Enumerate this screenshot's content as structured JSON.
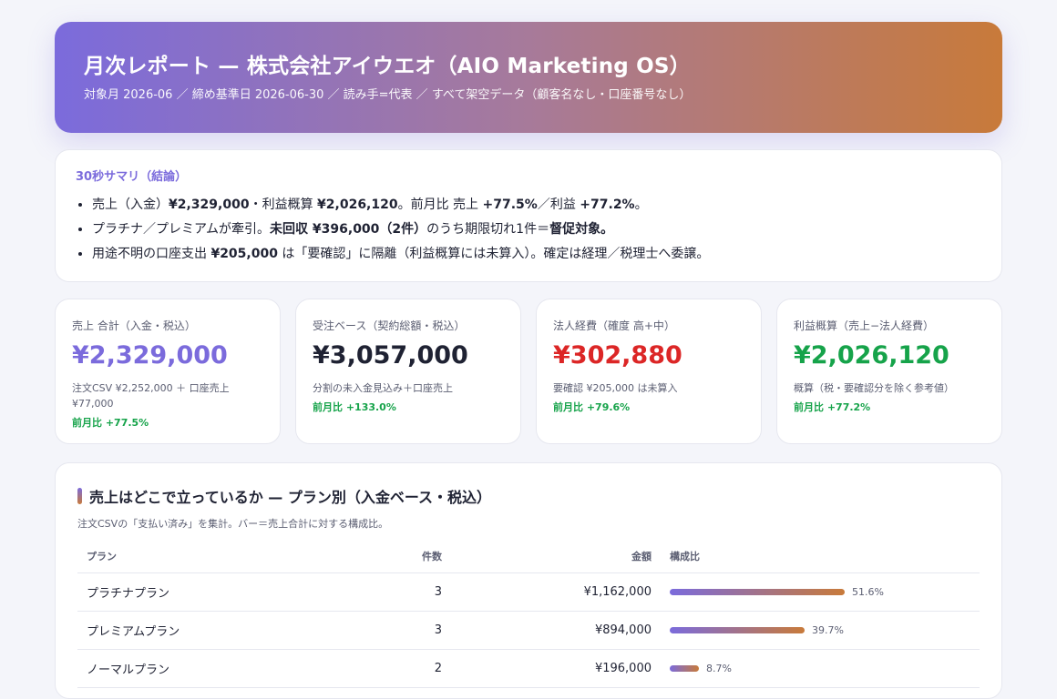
{
  "header": {
    "title": "月次レポート — 株式会社アイウエオ（AIO Marketing OS）",
    "subtitle": "対象月 2026-06 ／ 締め基準日 2026-06-30 ／ 読み手=代表 ／ すべて架空データ（顧客名なし・口座番号なし）"
  },
  "summary": {
    "label": "30秒サマリ（結論）",
    "bullet1": {
      "a": "売上（入金）",
      "b": "¥2,329,000",
      "c": "・利益概算 ",
      "d": "¥2,026,120",
      "e": "。前月比 売上 ",
      "f": "+77.5%",
      "g": "／利益 ",
      "h": "+77.2%",
      "i": "。"
    },
    "bullet2": {
      "a": "プラチナ／プレミアムが牽引。",
      "b": "未回収 ¥396,000（2件）",
      "c": "のうち期限切れ1件＝",
      "d": "督促対象。"
    },
    "bullet3": {
      "a": "用途不明の口座支出 ",
      "b": "¥205,000",
      "c": " は「要確認」に隔離（利益概算には未算入）。確定は経理／税理士へ委譲。"
    }
  },
  "kpis": [
    {
      "title": "売上 合計（入金・税込）",
      "value": "¥2,329,000",
      "note": "注文CSV ¥2,252,000 ＋ 口座売上 ¥77,000",
      "delta": "前月比 +77.5%",
      "color": "#7b6bdc"
    },
    {
      "title": "受注ベース（契約総額・税込）",
      "value": "¥3,057,000",
      "note": "分割の未入金見込み＋口座売上",
      "delta": "前月比 +133.0%",
      "color": "#1f2233"
    },
    {
      "title": "法人経費（確度 高+中）",
      "value": "¥302,880",
      "note": "要確認 ¥205,000 は未算入",
      "delta": "前月比 +79.6%",
      "color": "#dc2626"
    },
    {
      "title": "利益概算（売上−法人経費）",
      "value": "¥2,026,120",
      "note": "概算（税・要確認分を除く参考値）",
      "delta": "前月比 +77.2%",
      "color": "#16a34a"
    }
  ],
  "plan_section": {
    "title": "売上はどこで立っているか — プラン別（入金ベース・税込）",
    "note": "注文CSVの「支払い済み」を集計。バー＝売上合計に対する構成比。",
    "columns": [
      "プラン",
      "件数",
      "金額",
      "構成比"
    ],
    "rows": [
      {
        "plan": "プラチナプラン",
        "count": "3",
        "amount": "¥1,162,000",
        "share_pct": 51.6,
        "share_label": "51.6%"
      },
      {
        "plan": "プレミアムプラン",
        "count": "3",
        "amount": "¥894,000",
        "share_pct": 39.7,
        "share_label": "39.7%"
      },
      {
        "plan": "ノーマルプラン",
        "count": "2",
        "amount": "¥196,000",
        "share_pct": 8.7,
        "share_label": "8.7%"
      }
    ]
  }
}
